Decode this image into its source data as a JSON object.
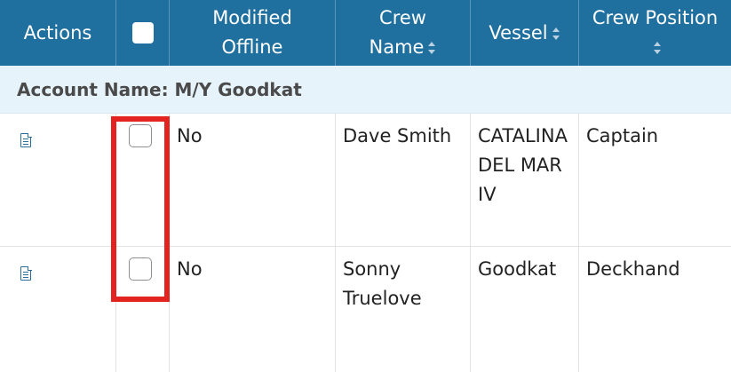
{
  "header": {
    "actions": "Actions",
    "modified_offline": "Modified Offline",
    "crew_name": "Crew Name",
    "vessel": "Vessel",
    "crew_position": "Crew Position"
  },
  "group": {
    "label": "Account Name: M/Y Goodkat"
  },
  "rows": [
    {
      "modified_offline": "No",
      "crew_name": "Dave Smith",
      "vessel": "CATALINA DEL MAR IV",
      "crew_position": "Captain",
      "selected": false
    },
    {
      "modified_offline": "No",
      "crew_name": "Sonny Truelove",
      "vessel": "Goodkat",
      "crew_position": "Deckhand",
      "selected": false
    }
  ],
  "colors": {
    "header_bg": "#1f6f9f",
    "group_bg": "#e6f3fb",
    "highlight": "#e32320"
  },
  "icons": {
    "row_action": "document-icon",
    "sort": "sort-icon"
  }
}
